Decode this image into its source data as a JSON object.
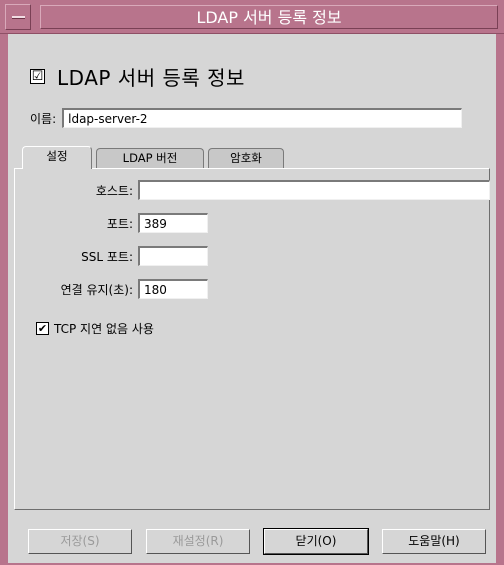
{
  "window": {
    "title": "LDAP 서버 등록 정보",
    "accent_color": "#b8748c"
  },
  "header": {
    "checked": true,
    "check_glyph": "☑",
    "label": "LDAP 서버 등록 정보"
  },
  "name": {
    "label": "이름:",
    "value": "ldap-server-2"
  },
  "tabs": [
    {
      "label": "설정",
      "active": true
    },
    {
      "label": "LDAP 버전",
      "active": false
    },
    {
      "label": "암호화",
      "active": false
    }
  ],
  "settings": {
    "host": {
      "label": "호스트:",
      "value": ""
    },
    "port": {
      "label": "포트:",
      "value": "389"
    },
    "ssl_port": {
      "label": "SSL 포트:",
      "value": ""
    },
    "keepalive": {
      "label": "연결 유지(초):",
      "value": "180"
    },
    "tcp_nodelay": {
      "label": "TCP 지연 없음 사용",
      "checked": true,
      "check_glyph": "✔"
    }
  },
  "buttons": {
    "save": "저장(S)",
    "reset": "재설정(R)",
    "close": "닫기(O)",
    "help": "도움말(H)"
  }
}
